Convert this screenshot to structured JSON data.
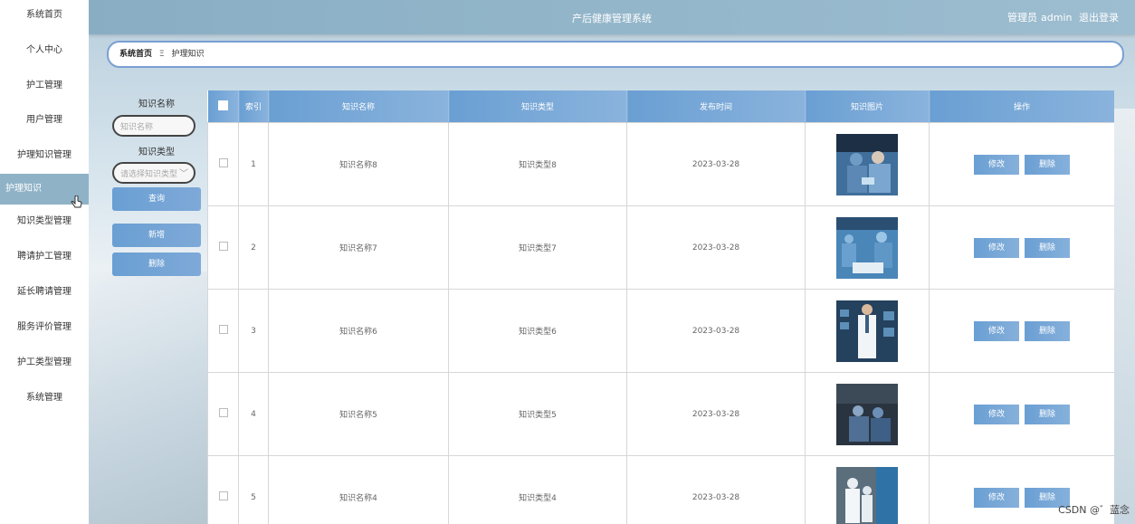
{
  "sidebar": {
    "items": [
      {
        "label": "系统首页"
      },
      {
        "label": "个人中心"
      },
      {
        "label": "护工管理"
      },
      {
        "label": "用户管理"
      },
      {
        "label": "护理知识管理"
      },
      {
        "label": "护理知识"
      },
      {
        "label": "知识类型管理"
      },
      {
        "label": "聘请护工管理"
      },
      {
        "label": "延长聘请管理"
      },
      {
        "label": "服务评价管理"
      },
      {
        "label": "护工类型管理"
      },
      {
        "label": "系统管理"
      }
    ]
  },
  "header": {
    "title": "产后健康管理系统",
    "role": "管理员",
    "username": "admin",
    "logout": "退出登录"
  },
  "breadcrumb": {
    "home": "系统首页",
    "separator": "Ξ",
    "current": "护理知识"
  },
  "search": {
    "name_label": "知识名称",
    "name_placeholder": "知识名称",
    "type_label": "知识类型",
    "type_placeholder": "请选择知识类型",
    "query_button": "查询",
    "add_button": "新增",
    "delete_button": "删除"
  },
  "table": {
    "headers": [
      "索引",
      "知识名称",
      "知识类型",
      "发布时间",
      "知识图片",
      "操作"
    ],
    "rows": [
      {
        "index": "1",
        "name": "知识名称8",
        "type": "知识类型8",
        "date": "2023-03-28"
      },
      {
        "index": "2",
        "name": "知识名称7",
        "type": "知识类型7",
        "date": "2023-03-28"
      },
      {
        "index": "3",
        "name": "知识名称6",
        "type": "知识类型6",
        "date": "2023-03-28"
      },
      {
        "index": "4",
        "name": "知识名称5",
        "type": "知识类型5",
        "date": "2023-03-28"
      },
      {
        "index": "5",
        "name": "知识名称4",
        "type": "知识类型4",
        "date": "2023-03-28"
      }
    ],
    "edit_label": "修改",
    "delete_label": "删除"
  },
  "watermark": "CSDN @゛蓝念",
  "colors": {
    "topbar": "#8fb2c6",
    "button": "#6a9fd3",
    "breadcrumb_border": "#7a9fd3",
    "active_sidebar": "#8fb2c6"
  }
}
